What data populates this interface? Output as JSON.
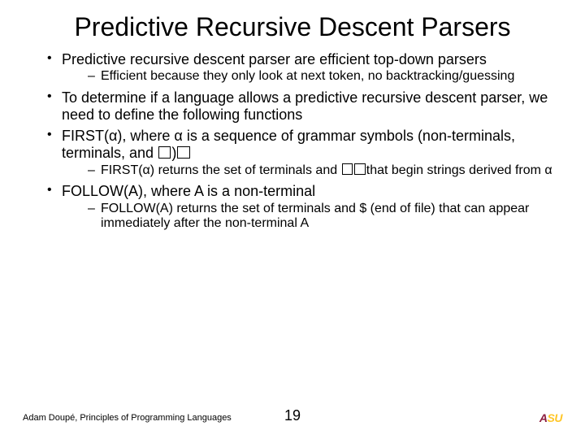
{
  "title": "Predictive Recursive Descent Parsers",
  "bullets": {
    "b1": "Predictive recursive descent parser are efficient top-down parsers",
    "b1s1": "Efficient because they only look at next token, no backtracking/guessing",
    "b2": "To determine if a language allows a predictive recursive descent parser, we need to define the following functions",
    "b3a": "FIRST(α), where α is a sequence of grammar symbols (non-terminals, terminals, and ",
    "b3b": ")",
    "b3s1a": "FIRST(α) returns the set of terminals and ",
    "b3s1b": "that begin strings derived from α",
    "b4": "FOLLOW(A), where A is a non-terminal",
    "b4s1": "FOLLOW(A) returns the set of terminals and $ (end of file) that can appear immediately after the non-terminal A"
  },
  "footer": "Adam Doupé, Principles of Programming Languages",
  "page": "19",
  "logo": {
    "a": "A",
    "su": "SU"
  }
}
